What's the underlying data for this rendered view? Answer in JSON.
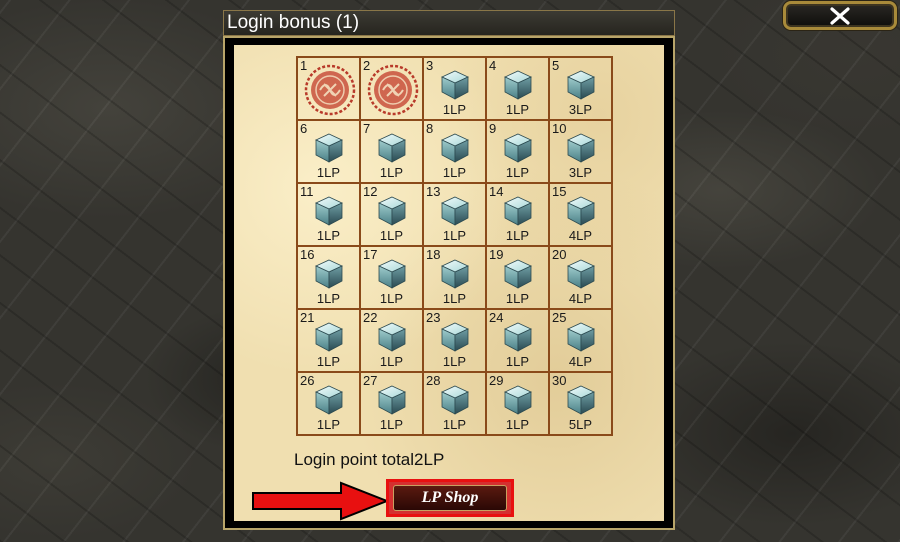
{
  "dialog": {
    "title": "Login bonus (1)"
  },
  "close_button": {
    "icon": "close-icon"
  },
  "calendar": {
    "days": [
      {
        "day": "1",
        "claimed": true,
        "reward": ""
      },
      {
        "day": "2",
        "claimed": true,
        "reward": ""
      },
      {
        "day": "3",
        "claimed": false,
        "reward": "1LP"
      },
      {
        "day": "4",
        "claimed": false,
        "reward": "1LP"
      },
      {
        "day": "5",
        "claimed": false,
        "reward": "3LP"
      },
      {
        "day": "6",
        "claimed": false,
        "reward": "1LP"
      },
      {
        "day": "7",
        "claimed": false,
        "reward": "1LP"
      },
      {
        "day": "8",
        "claimed": false,
        "reward": "1LP"
      },
      {
        "day": "9",
        "claimed": false,
        "reward": "1LP"
      },
      {
        "day": "10",
        "claimed": false,
        "reward": "3LP"
      },
      {
        "day": "11",
        "claimed": false,
        "reward": "1LP"
      },
      {
        "day": "12",
        "claimed": false,
        "reward": "1LP"
      },
      {
        "day": "13",
        "claimed": false,
        "reward": "1LP"
      },
      {
        "day": "14",
        "claimed": false,
        "reward": "1LP"
      },
      {
        "day": "15",
        "claimed": false,
        "reward": "4LP"
      },
      {
        "day": "16",
        "claimed": false,
        "reward": "1LP"
      },
      {
        "day": "17",
        "claimed": false,
        "reward": "1LP"
      },
      {
        "day": "18",
        "claimed": false,
        "reward": "1LP"
      },
      {
        "day": "19",
        "claimed": false,
        "reward": "1LP"
      },
      {
        "day": "20",
        "claimed": false,
        "reward": "4LP"
      },
      {
        "day": "21",
        "claimed": false,
        "reward": "1LP"
      },
      {
        "day": "22",
        "claimed": false,
        "reward": "1LP"
      },
      {
        "day": "23",
        "claimed": false,
        "reward": "1LP"
      },
      {
        "day": "24",
        "claimed": false,
        "reward": "1LP"
      },
      {
        "day": "25",
        "claimed": false,
        "reward": "4LP"
      },
      {
        "day": "26",
        "claimed": false,
        "reward": "1LP"
      },
      {
        "day": "27",
        "claimed": false,
        "reward": "1LP"
      },
      {
        "day": "28",
        "claimed": false,
        "reward": "1LP"
      },
      {
        "day": "29",
        "claimed": false,
        "reward": "1LP"
      },
      {
        "day": "30",
        "claimed": false,
        "reward": "5LP"
      }
    ]
  },
  "total": {
    "text": "Login point total2LP"
  },
  "shop_button": {
    "label": "LP Shop"
  },
  "colors": {
    "highlight": "#e81010",
    "grid_line": "#8a4a1a",
    "paper": "#f0dfb0"
  }
}
